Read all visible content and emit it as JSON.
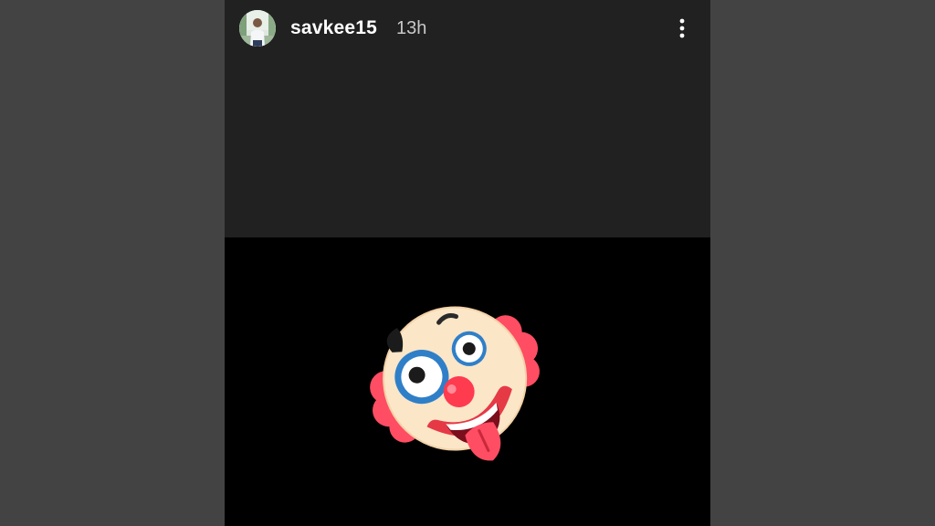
{
  "story": {
    "username": "savkee15",
    "time_ago": "13h",
    "more_icon": "more-vertical-icon",
    "avatar_icon": "profile-photo",
    "sticker_icon": "clown-face-emoji"
  },
  "colors": {
    "outer_background": "#434343",
    "story_top_background": "#212121",
    "story_bottom_background": "#000000",
    "username": "#ffffff",
    "timestamp": "#c8c8c8"
  }
}
